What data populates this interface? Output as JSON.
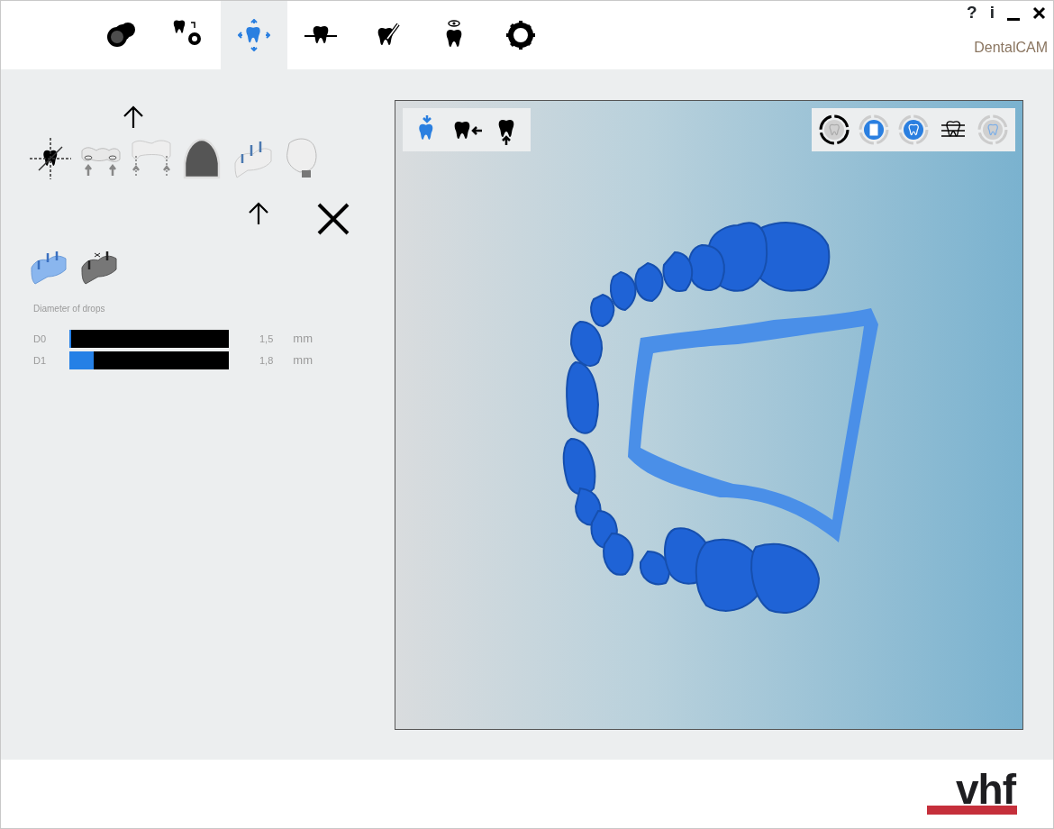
{
  "header": {
    "tabs": [
      {
        "kind": "case",
        "selected": false
      },
      {
        "kind": "scan",
        "selected": false
      },
      {
        "kind": "align",
        "selected": true
      },
      {
        "kind": "axis",
        "selected": false
      },
      {
        "kind": "design",
        "selected": false
      },
      {
        "kind": "view",
        "selected": false
      },
      {
        "kind": "settings",
        "selected": false
      }
    ],
    "help": "?",
    "info": "i",
    "app_title": "DentalCAM"
  },
  "left_panel": {
    "tools": [
      {
        "kind": "coordinate"
      },
      {
        "kind": "bridge-arrows"
      },
      {
        "kind": "bridge-lines"
      },
      {
        "kind": "arch"
      },
      {
        "kind": "pins"
      },
      {
        "kind": "crown"
      }
    ],
    "mode_tools": [
      {
        "kind": "pins-blue"
      },
      {
        "kind": "pins-grey"
      }
    ],
    "drops": {
      "title": "Diameter of drops",
      "sliders": [
        {
          "label": "D0",
          "level": 0.01,
          "reading": "1,5",
          "unit": "mm"
        },
        {
          "label": "D1",
          "level": 0.15,
          "reading": "1,8",
          "unit": "mm"
        }
      ]
    }
  },
  "viewer": {
    "left_tools": [
      {
        "kind": "tooth-down",
        "selected": true
      },
      {
        "kind": "tooth-left",
        "selected": false
      },
      {
        "kind": "tooth-up",
        "selected": false
      }
    ],
    "right_tools": [
      {
        "kind": "round",
        "selected": true,
        "on": false
      },
      {
        "kind": "square",
        "selected": false,
        "on": true
      },
      {
        "kind": "round",
        "selected": false,
        "on": true
      },
      {
        "kind": "bridge",
        "selected": false,
        "on": false
      },
      {
        "kind": "round",
        "selected": false,
        "on": false
      }
    ]
  },
  "footer": {
    "logo": "vhf"
  }
}
